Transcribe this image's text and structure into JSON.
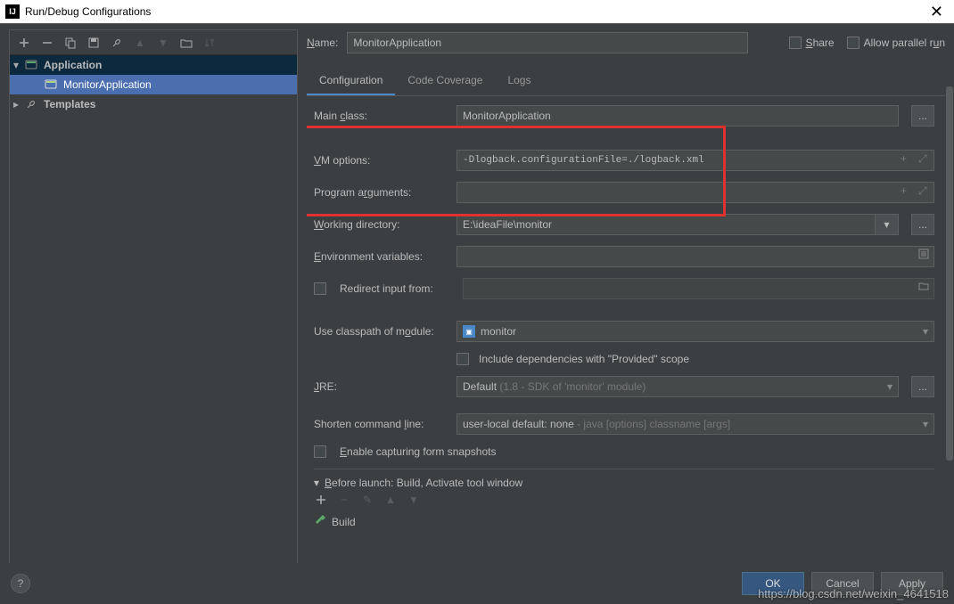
{
  "window": {
    "title": "Run/Debug Configurations"
  },
  "sidebar": {
    "nodes": {
      "application": "Application",
      "monitor": "MonitorApplication",
      "templates": "Templates"
    }
  },
  "name": {
    "label": "Name:",
    "value": "MonitorApplication"
  },
  "topChecks": {
    "share": "Share",
    "parallel": "Allow parallel run"
  },
  "tabs": {
    "config": "Configuration",
    "coverage": "Code Coverage",
    "logs": "Logs"
  },
  "form": {
    "mainClass": {
      "label": "Main class:",
      "value": "MonitorApplication"
    },
    "vmOptions": {
      "label": "VM options:",
      "value": "-Dlogback.configurationFile=./logback.xml"
    },
    "programArgs": {
      "label": "Program arguments:",
      "value": ""
    },
    "workingDir": {
      "label": "Working directory:",
      "value": "E:\\ideaFile\\monitor"
    },
    "envVars": {
      "label": "Environment variables:",
      "value": ""
    },
    "redirect": {
      "label": "Redirect input from:",
      "value": ""
    },
    "module": {
      "label": "Use classpath of module:",
      "value": "monitor"
    },
    "includeProvided": "Include dependencies with \"Provided\" scope",
    "jre": {
      "label": "JRE:",
      "value": "Default",
      "hint": "(1.8 - SDK of 'monitor' module)"
    },
    "shorten": {
      "label": "Shorten command line:",
      "value": "user-local default: none",
      "hint": "- java [options] classname [args]"
    },
    "snapshots": "Enable capturing form snapshots"
  },
  "beforeLaunch": {
    "header": "Before launch: Build, Activate tool window",
    "build": "Build"
  },
  "buttons": {
    "ok": "OK",
    "cancel": "Cancel",
    "apply": "Apply"
  },
  "watermark": "https://blog.csdn.net/weixin_4641518"
}
